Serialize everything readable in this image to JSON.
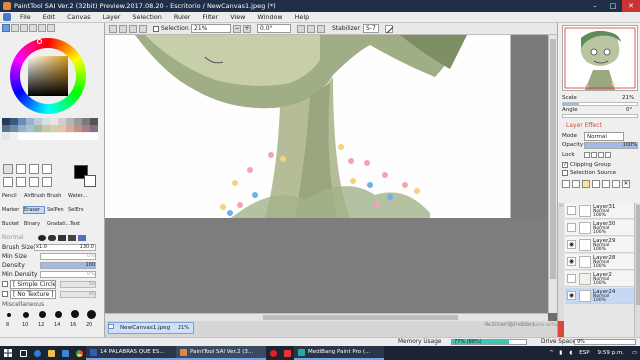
{
  "titlebar": {
    "title": "PaintTool SAI Ver.2 (32bit) Preview.2017.08.20 - Escritorio / NewCanvas1.jpeg (*)",
    "min": "–",
    "max": "□",
    "close": "✕"
  },
  "menu": [
    "File",
    "Edit",
    "Canvas",
    "Layer",
    "Selection",
    "Ruler",
    "Filter",
    "View",
    "Window",
    "Help"
  ],
  "options": {
    "selection_label": "Selection",
    "zoom": "21%",
    "angle": "0.0°",
    "stabilizer_label": "Stabilizer",
    "stabilizer": "S-7"
  },
  "tools": {
    "row1": [
      "Pencil",
      "AirBrush",
      "Brush",
      "Water..."
    ],
    "row2": [
      "Marker",
      "Eraser",
      "SelPen",
      "SelErs"
    ],
    "row3": [
      "Bucket",
      "Binary",
      "Gradati...",
      "Text"
    ],
    "normal_label": "Normal"
  },
  "brush": {
    "size_label": "Brush Size",
    "size_mult": "x1.0",
    "size": "130.0",
    "min_size_label": "Min Size",
    "min_size": "0%",
    "density_label": "Density",
    "density": "100",
    "min_density_label": "Min Density",
    "min_density": "0%",
    "shape": "[ Simple Circle ]",
    "shape_val": "50",
    "texture": "[ No Texture ]",
    "texture_val": "95",
    "misc_label": "Miscellaneous",
    "sizes": [
      "8",
      "10",
      "12",
      "14",
      "16",
      "20"
    ]
  },
  "right": {
    "scale_label": "Scale",
    "scale": "21%",
    "angle_label": "Angle",
    "angle": "0°",
    "layer_effect": "Layer Effect",
    "mode_label": "Mode",
    "mode": "Normal",
    "opacity_label": "Opacity",
    "opacity": "100%",
    "lock_label": "Lock",
    "clipping_group": "Clipping Group",
    "selection_source": "Selection Source"
  },
  "layers": [
    {
      "name": "Layer31",
      "mode": "Normal",
      "opacity": "100%"
    },
    {
      "name": "Layer30",
      "mode": "Normal",
      "opacity": "100%"
    },
    {
      "name": "Layer29",
      "mode": "Normal",
      "opacity": "100%"
    },
    {
      "name": "Layer28",
      "mode": "Normal",
      "opacity": "100%"
    },
    {
      "name": "Layer2",
      "mode": "Normal",
      "opacity": "100%"
    },
    {
      "name": "Layer24",
      "mode": "Normal",
      "opacity": "100%"
    }
  ],
  "document_tab": {
    "name": "NewCanvas1.jpeg",
    "zoom": "21%"
  },
  "status": {
    "memory_label": "Memory Usage",
    "memory": "77% (88%)",
    "drive_label": "Drive Space",
    "drive": "9%",
    "memory_fraction": 0.77
  },
  "watermark": {
    "line1": "Activar Windows",
    "line2": "Ve a Configuración para activar Windows."
  },
  "taskbar": {
    "apps": [
      "14 PALABRAS QUE ES...",
      "PaintTool SAI Ver.2 (3...",
      "MediBang Paint Pro (..."
    ],
    "lang": "ESP",
    "time": "9:59 p.m."
  },
  "colors": {
    "accent": "#3b78d8",
    "titlebar": "#1f2f48",
    "taskbar": "#1b2432",
    "layer_effect": "#d9483b",
    "memory_bar": "#3cc8b4"
  }
}
